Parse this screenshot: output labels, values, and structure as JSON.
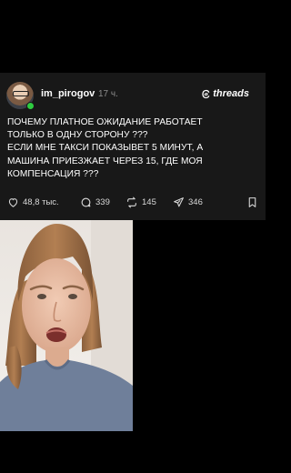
{
  "post": {
    "username": "im_pirogov",
    "time": "17 ч.",
    "brand": "threads",
    "lines": [
      "ПОЧЕМУ ПЛАТНОЕ ОЖИДАНИЕ РАБОТАЕТ",
      "ТОЛЬКО В ОДНУ СТОРОНУ ???",
      "ЕСЛИ МНЕ ТАКСИ ПОКАЗЫВЕТ 5 МИНУТ, А",
      "МАШИНА ПРИЕЗЖАЕТ ЧЕРЕЗ 15, ГДЕ МОЯ",
      "КОМПЕНСАЦИЯ ???"
    ],
    "actions": {
      "likes": "48,8 тыс.",
      "comments": "339",
      "reposts": "145",
      "shares": "346"
    }
  },
  "colors": {
    "card_bg": "#181818",
    "page_bg": "#000000",
    "muted_text": "#8b8b8b",
    "verified": "#2ecc40"
  },
  "icons": [
    "heart-icon",
    "comment-icon",
    "repost-icon",
    "share-icon",
    "bookmark-icon",
    "threads-logo-icon"
  ]
}
